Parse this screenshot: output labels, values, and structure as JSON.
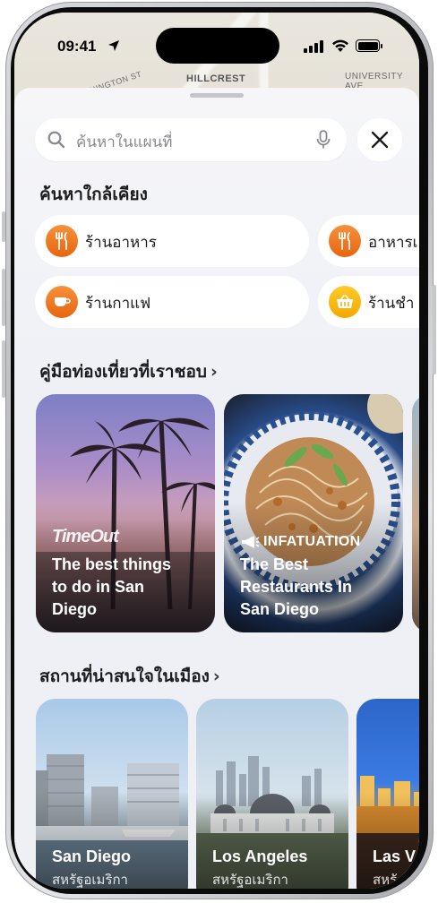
{
  "status": {
    "time": "09:41"
  },
  "map": {
    "labels": [
      "HILLCREST",
      "UNIVERSITY AVE",
      "WASHINGTON ST"
    ]
  },
  "search": {
    "placeholder": "ค้นหาในแผนที่"
  },
  "nearby": {
    "title": "ค้นหาใกล้เคียง",
    "items": [
      {
        "label": "ร้านอาหาร",
        "icon": "fork-knife-icon",
        "color": "#f07a1c"
      },
      {
        "label": "อาหารเ",
        "icon": "fork-knife-icon",
        "color": "#f07a1c"
      },
      {
        "label": "ร้านกาแฟ",
        "icon": "coffee-cup-icon",
        "color": "#f07a1c"
      },
      {
        "label": "ร้านชำ",
        "icon": "basket-icon",
        "color": "#f5b400"
      }
    ]
  },
  "guides": {
    "title": "คู่มือท่องเที่ยวที่เราชอบ",
    "chevron": "›",
    "cards": [
      {
        "brand": "TimeOut",
        "title_lines": [
          "The best things",
          "to do in San",
          "Diego"
        ]
      },
      {
        "brand": "INFATUATION",
        "title_lines": [
          "The Best",
          "Restaurants In",
          "San Diego"
        ]
      }
    ]
  },
  "cities": {
    "title": "สถานที่น่าสนใจในเมือง",
    "chevron": "›",
    "cards": [
      {
        "name": "San Diego",
        "country": "สหรัฐอเมริกา"
      },
      {
        "name": "Los Angeles",
        "country": "สหรัฐอเมริกา"
      },
      {
        "name": "Las V",
        "country": "สหรั"
      }
    ]
  }
}
